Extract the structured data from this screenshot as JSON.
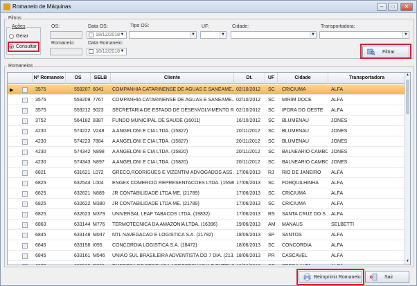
{
  "window": {
    "title": "Romaneio de Máquinas"
  },
  "filtros": {
    "group_label": "Filtros",
    "acoes_label": "Ações",
    "gerar_label": "Gerar",
    "consultar_label": "Consultar",
    "os_label": "OS:",
    "data_os_label": "Data OS:",
    "data_os_value": "18/12/2018",
    "tipo_os_label": "Tipo OS:",
    "uf_label": "UF:",
    "cidade_label": "Cidade:",
    "transportadora_label": "Transportadora:",
    "romaneio_label": "Romaneio:",
    "data_romaneio_label": "Data Romaneio:",
    "data_romaneio_value": "18/12/2018",
    "filtrar_label": "Filtrar"
  },
  "romaneios": {
    "group_label": "Romaneios",
    "columns": [
      "Nº Romaneio",
      "OS",
      "SELB",
      "Cliente",
      "Dt. Romaneio",
      "UF",
      "Cidade",
      "Transportadora"
    ],
    "rows": [
      [
        "3575",
        "559207",
        "6041",
        "COMPANHIA CATARINENSE DE AGUAS E SANEAME...",
        "02/10/2012",
        "SC",
        "CRICIUMA",
        "ALFA"
      ],
      [
        "3575",
        "559209",
        "7767",
        "COMPANHIA CATARINENSE DE AGUAS E SANEAME...",
        "02/10/2012",
        "SC",
        "MIRIM DOCE",
        "ALFA"
      ],
      [
        "3575",
        "559212",
        "9023",
        "SECRETARIA DE ESTADO DE DESENVOLVIMENTO R...",
        "02/10/2012",
        "SC",
        "IPORA DO OESTE",
        "ALFA"
      ],
      [
        "3752",
        "564182",
        "8387",
        "FUNDO MUNICIPAL DE SAUDE (16011)",
        "16/10/2012",
        "SC",
        "BLUMENAU",
        "JONES"
      ],
      [
        "4230",
        "574222",
        "V248",
        "A ANGELONI E CIA LTDA. (15827)",
        "20/11/2012",
        "SC",
        "BLUMENAU",
        "JONES"
      ],
      [
        "4230",
        "574223",
        "7884",
        "A ANGELONI E CIA LTDA. (15827)",
        "20/11/2012",
        "SC",
        "BLUMENAU",
        "JONES"
      ],
      [
        "4230",
        "574342",
        "N898",
        "A ANGELONI E CIA LTDA. (15820)",
        "20/11/2012",
        "SC",
        "BALNEARIO CAMBO...",
        "JONES"
      ],
      [
        "4230",
        "574343",
        "N897",
        "A ANGELONI E CIA LTDA. (15820)",
        "20/11/2012",
        "SC",
        "BALNEARIO CAMBO...",
        "JONES"
      ],
      [
        "6821",
        "631621",
        "L072",
        "GRECO,RODRIGUES E VIZENTIM ADVOGADOS ASS...",
        "17/06/2013",
        "RJ",
        "RIO DE JANEIRO",
        "ALFA"
      ],
      [
        "6825",
        "632544",
        "L004",
        "ENGEX COMERCIO REPRESENTACOES LTDA. (15580)",
        "17/06/2013",
        "SC",
        "FORQUILHINHA",
        "ALFA"
      ],
      [
        "6825",
        "632621",
        "N889",
        "JR CONTABILIDADE LTDA ME. (21789)",
        "17/06/2013",
        "SC",
        "CRICIUMA",
        "ALFA"
      ],
      [
        "6825",
        "632622",
        "M380",
        "JR CONTABILIDADE LTDA ME. (21789)",
        "17/06/2013",
        "SC",
        "CRICIUMA",
        "ALFA"
      ],
      [
        "6825",
        "632623",
        "M379",
        "UNIVERSAL LEAF TABACOS LTDA. (19832)",
        "17/06/2013",
        "RS",
        "SANTA CRUZ DO S...",
        "ALFA"
      ],
      [
        "6863",
        "633144",
        "M776",
        "TERMOTECNICA DA AMAZONIA LTDA. (16396)",
        "19/06/2013",
        "AM",
        "MANAUS",
        "SELBETTI"
      ],
      [
        "6845",
        "633148",
        "M047",
        "NTL NAVEGACAO E LOGISTICA S.A. (21792)",
        "18/06/2013",
        "SP",
        "SANTOS",
        "ALFA"
      ],
      [
        "6845",
        "633158",
        "I055",
        "CONCORDIA LOGISTICA S.A. (18472)",
        "18/06/2013",
        "SC",
        "CONCORDIA",
        "ALFA"
      ],
      [
        "6845",
        "633161",
        "M546",
        "UNIAO SUL BRASILEIRA ADVENTISTA DO 7 DIA. (213...",
        "18/06/2013",
        "PR",
        "CASCAVEL",
        "ALFA"
      ],
      [
        "6872",
        "633502",
        "R722",
        "EMPRESA DE PESQUISA AGROPECUARIA E EXTENS...",
        "19/06/2013",
        "SC",
        "SERRA ALTA",
        "ALFA"
      ]
    ]
  },
  "footer": {
    "reimprimir_label": "Reimprimir Romaneio",
    "sair_label": "Sair"
  }
}
